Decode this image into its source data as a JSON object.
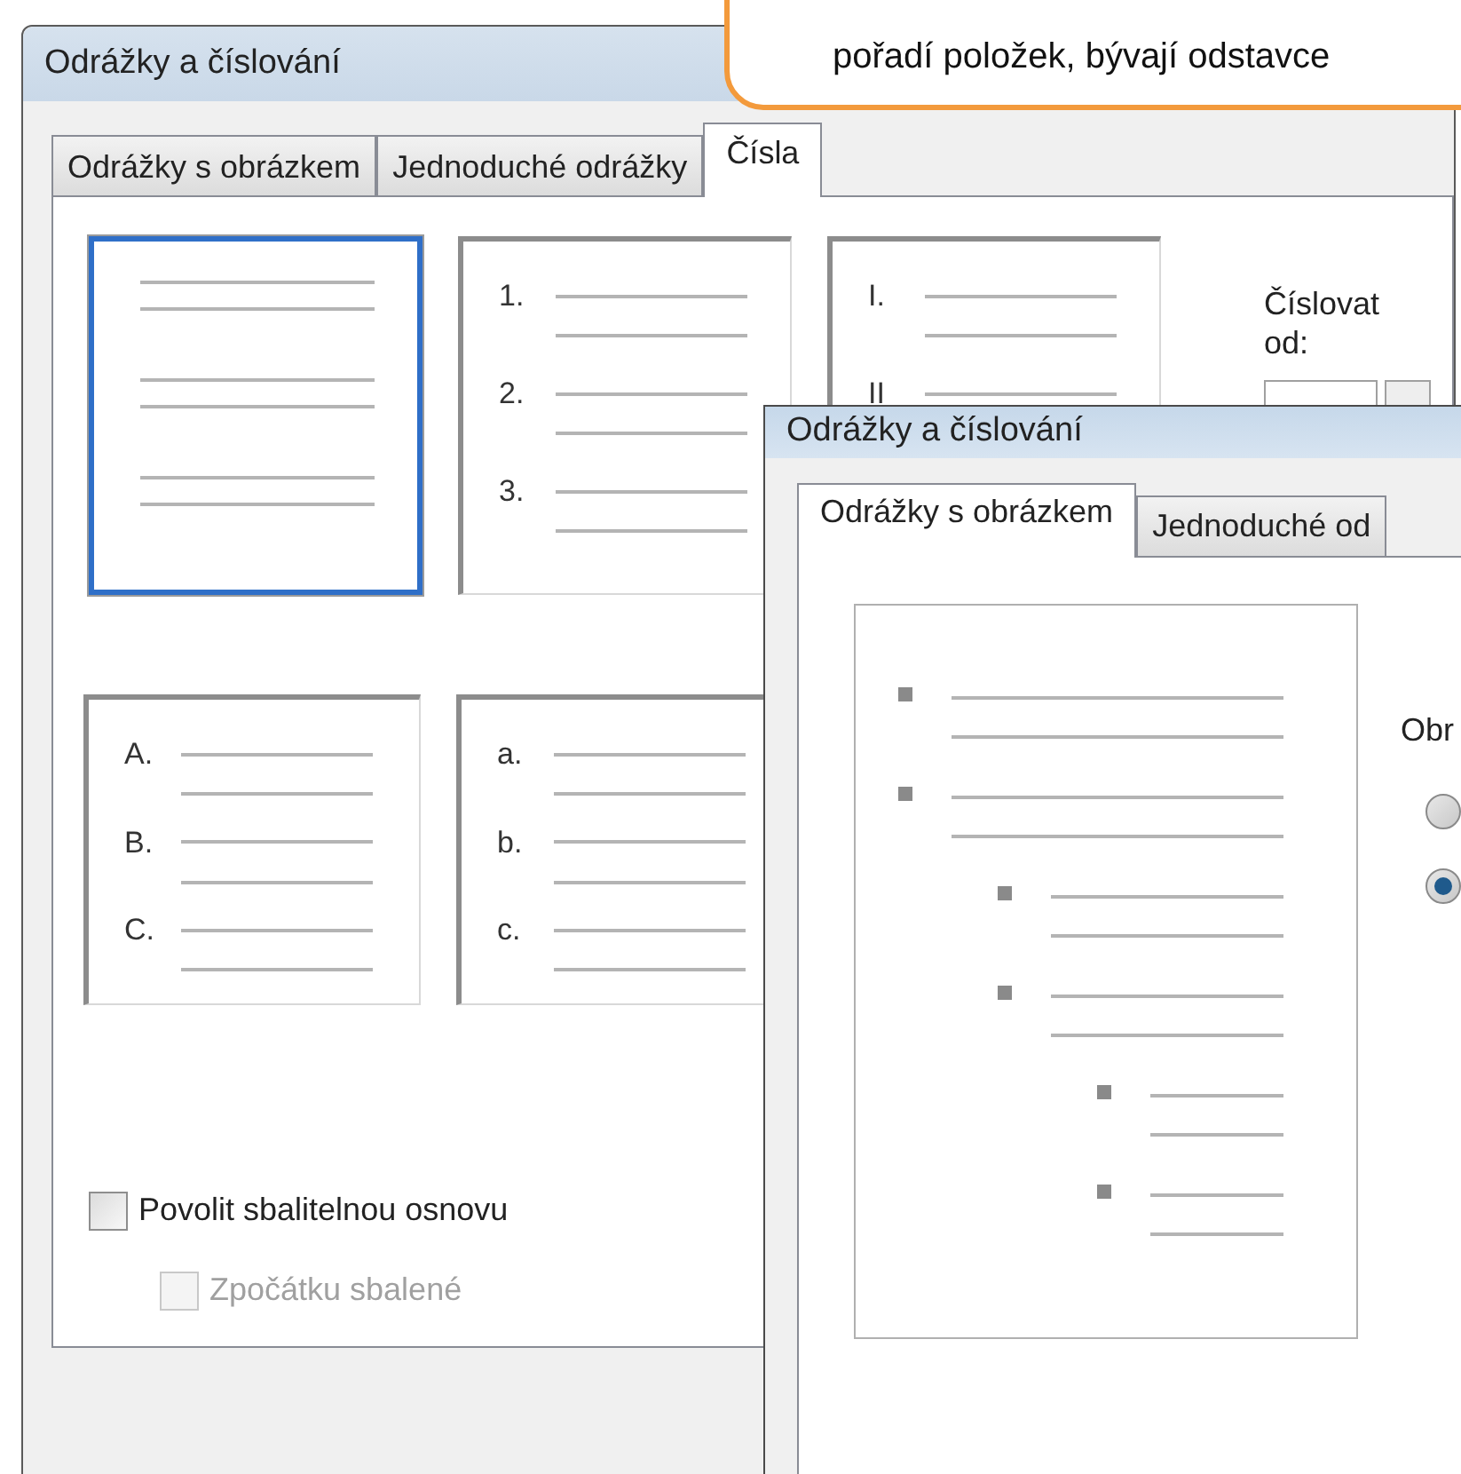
{
  "callout": {
    "text": "pořadí položek, bývají odstavce"
  },
  "numbering_dialog": {
    "title": "Odrážky a číslování",
    "tabs": [
      {
        "label": "Odrážky s obrázkem",
        "selected": false
      },
      {
        "label": "Jednoduché odrážky",
        "selected": false
      },
      {
        "label": "Čísla",
        "selected": true
      }
    ],
    "formats": [
      {
        "selected": true
      },
      {
        "selected": false,
        "labels": [
          "1.",
          "2.",
          "3."
        ]
      },
      {
        "selected": false,
        "labels": [
          "I.",
          "II"
        ]
      },
      {
        "selected": false,
        "labels": [
          "A.",
          "B.",
          "C."
        ]
      },
      {
        "selected": false,
        "labels": [
          "a.",
          "b.",
          "c."
        ]
      }
    ],
    "start_label": "Číslovat od:",
    "checkboxes": [
      {
        "label": "Povolit sbalitelnou osnovu",
        "checked": false,
        "disabled": false
      },
      {
        "label": "Zpočátku sbalené",
        "checked": false,
        "disabled": true
      }
    ]
  },
  "bullets_dialog": {
    "title": "Odrážky a číslování",
    "tabs": [
      {
        "label": "Odrážky s obrázkem",
        "selected": true
      },
      {
        "label": "Jednoduché od",
        "selected": false
      }
    ],
    "section_label": "Obr",
    "radios": [
      {
        "selected": false
      },
      {
        "selected": true
      }
    ]
  }
}
